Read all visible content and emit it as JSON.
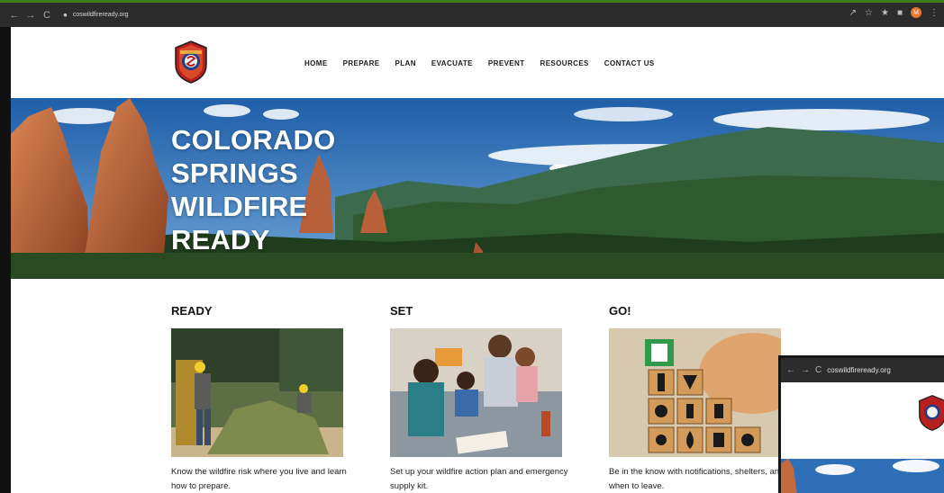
{
  "browser": {
    "url": "coswildfireready.org",
    "nav_back": "←",
    "nav_forward": "→",
    "nav_reload": "C",
    "lock_icon": "🔒",
    "avatar_letter": "M"
  },
  "site": {
    "nav": [
      "HOME",
      "PREPARE",
      "PLAN",
      "EVACUATE",
      "PREVENT",
      "RESOURCES",
      "CONTACT US"
    ],
    "hero_title": [
      "COLORADO",
      "SPRINGS",
      "WILDFIRE",
      "READY"
    ]
  },
  "cards": [
    {
      "heading": "READY",
      "desc": "Know the wildfire risk where you live and learn how to prepare."
    },
    {
      "heading": "SET",
      "desc": "Set up your wildfire action plan and emergency supply kit."
    },
    {
      "heading": "GO!",
      "desc": "Be in the know with notifications, shelters, and when to leave."
    }
  ],
  "inset": {
    "url": "coswildfireready.org",
    "nav_back": "←",
    "nav_forward": "→",
    "nav_reload": "C"
  },
  "colors": {
    "chrome": "#2c2c2c",
    "accent_green": "#3a7d1d",
    "sky": "#2f6fb8"
  }
}
